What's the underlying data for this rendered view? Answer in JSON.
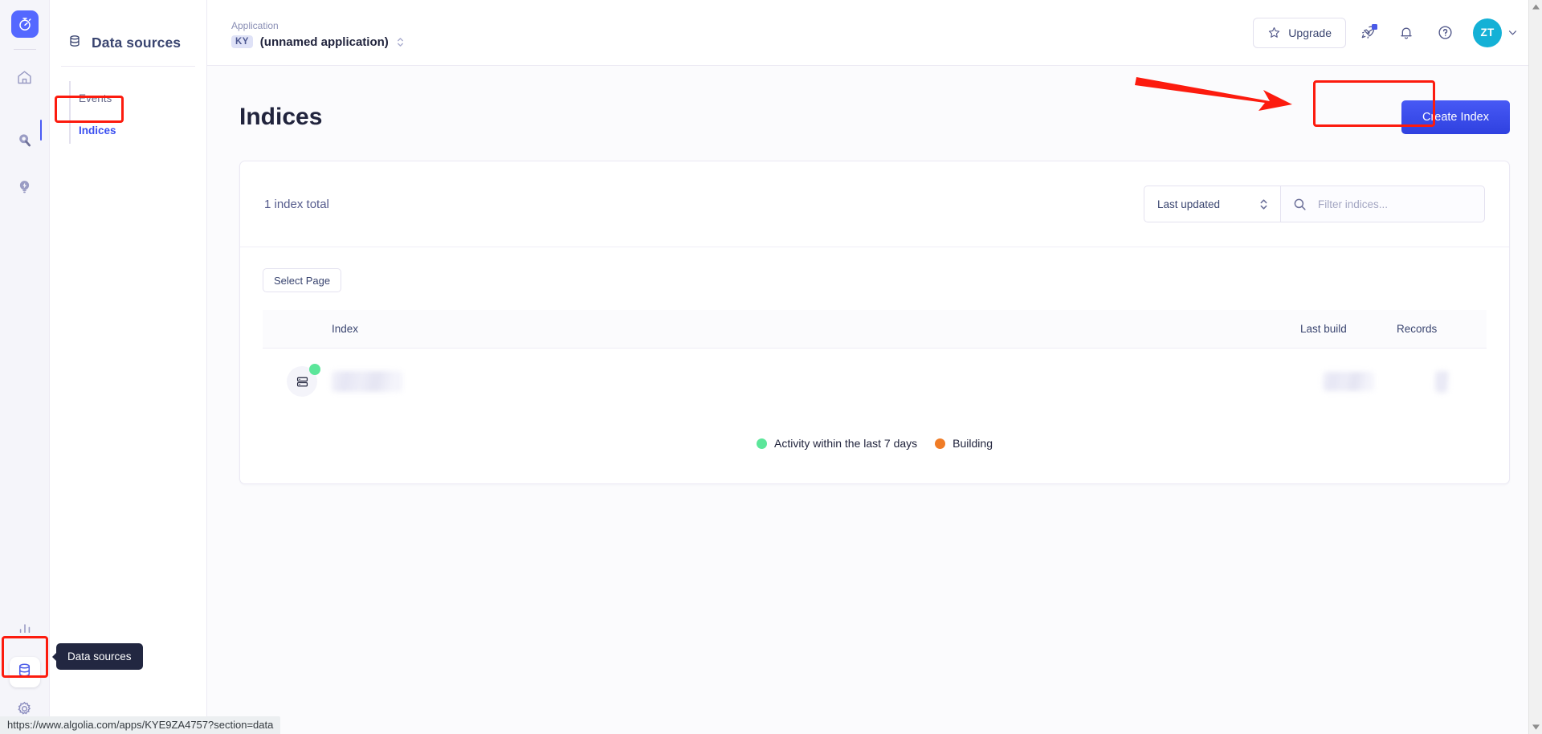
{
  "rail": {
    "logo_icon": "algolia-stopwatch-logo",
    "items": [
      {
        "name": "home",
        "icon": "home-icon"
      },
      {
        "name": "search",
        "icon": "search-magnifier-icon"
      },
      {
        "name": "recommend",
        "icon": "lightbulb-bolt-icon"
      }
    ],
    "bottom_items": [
      {
        "name": "analytics",
        "icon": "bar-chart-icon"
      },
      {
        "name": "data-sources",
        "icon": "database-icon",
        "active": true
      },
      {
        "name": "settings",
        "icon": "gear-icon"
      }
    ],
    "tooltip": "Data sources"
  },
  "sidebar": {
    "title": "Data sources",
    "title_icon": "database-icon",
    "items": [
      {
        "label": "Events",
        "active": false
      },
      {
        "label": "Indices",
        "active": true
      }
    ]
  },
  "topbar": {
    "application_label": "Application",
    "application_badge": "KY",
    "application_name": "(unnamed application)",
    "selector_icon": "chevron-up-down-icon",
    "upgrade_label": "Upgrade",
    "upgrade_icon": "star-icon",
    "actions": [
      {
        "name": "whats-new",
        "icon": "rocket-icon"
      },
      {
        "name": "notifications",
        "icon": "bell-icon"
      },
      {
        "name": "help",
        "icon": "question-circle-icon"
      }
    ],
    "avatar_initials": "ZT",
    "avatar_color": "#14b1d6",
    "avatar_chevron_icon": "chevron-down-icon"
  },
  "page": {
    "title": "Indices",
    "create_button": "Create Index",
    "create_button_color": "#3447e8"
  },
  "card": {
    "index_total": "1 index total",
    "sort_value": "Last updated",
    "sort_icon": "chevron-up-down-icon",
    "search_icon": "search-icon",
    "search_placeholder": "Filter indices...",
    "search_value": "",
    "select_page_label": "Select Page",
    "columns": [
      "Index",
      "Last build",
      "Records"
    ],
    "rows": [
      {
        "icon": "server-stack-icon",
        "status": "active",
        "status_color": "#5ce69a",
        "name": "",
        "last_build": "",
        "records": ""
      }
    ],
    "legend": [
      {
        "label": "Activity within the last 7 days",
        "color": "#5ce69a"
      },
      {
        "label": "Building",
        "color": "#f07c26"
      }
    ]
  },
  "annotations": {
    "highlight_color": "#fc1b0e",
    "arrow_target": "create-index-button"
  },
  "statusbar": {
    "url": "https://www.algolia.com/apps/KYE9ZA4757?section=data"
  }
}
